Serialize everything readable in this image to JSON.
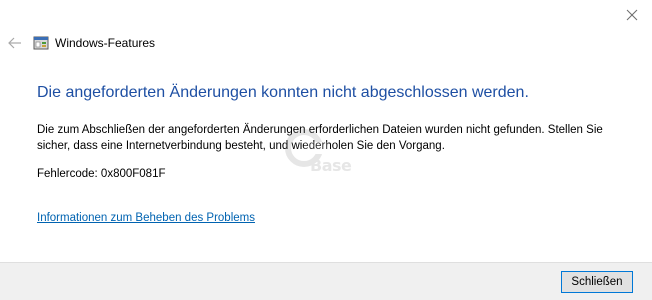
{
  "window": {
    "title": "Windows-Features"
  },
  "content": {
    "main_instruction": "Die angeforderten Änderungen konnten nicht abgeschlossen werden.",
    "description": "Die zum Abschließen der angeforderten Änderungen erforderlichen Dateien wurden nicht gefunden. Stellen Sie sicher, dass eine Internetverbindung besteht, und wiederholen Sie den Vorgang.",
    "error_code": "Fehlercode: 0x800F081F",
    "help_link": "Informationen zum Beheben des Problems"
  },
  "watermark": {
    "text": "Base"
  },
  "footer": {
    "close_button_label": "Schließen"
  },
  "icons": {
    "close": "close-icon",
    "back": "back-arrow-icon",
    "app": "windows-features-icon"
  },
  "colors": {
    "heading": "#1e4fa3",
    "link": "#0063b1",
    "footer_background": "#f0f0f0"
  }
}
